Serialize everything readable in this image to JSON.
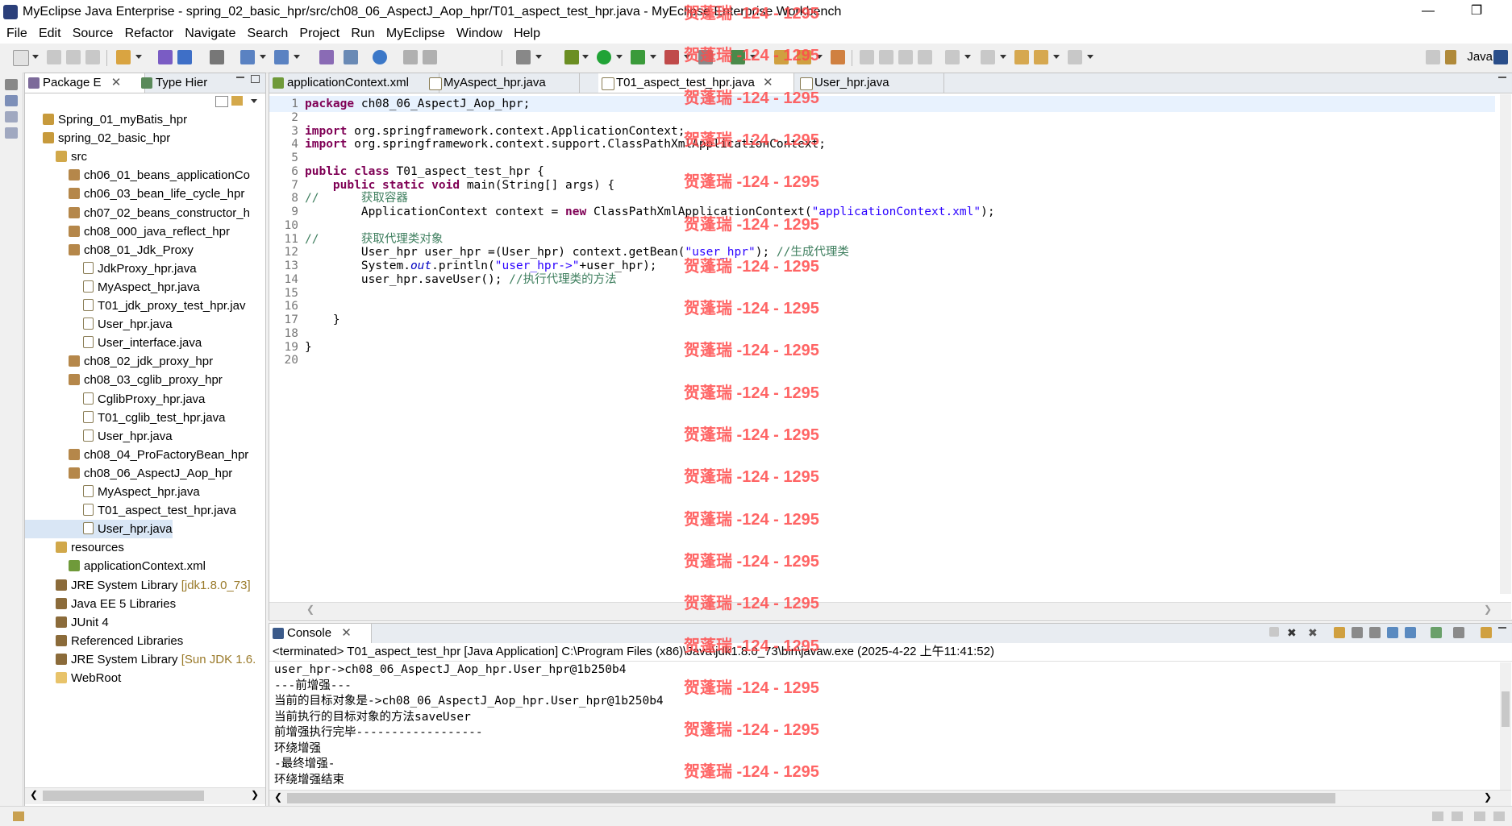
{
  "window": {
    "title": "MyEclipse Java Enterprise - spring_02_basic_hpr/src/ch08_06_AspectJ_Aop_hpr/T01_aspect_test_hpr.java - MyEclipse Enterprise Workbench",
    "minimize": "—",
    "restore": "❐"
  },
  "menu": [
    "File",
    "Edit",
    "Source",
    "Refactor",
    "Navigate",
    "Search",
    "Project",
    "Run",
    "MyEclipse",
    "Window",
    "Help"
  ],
  "toolbar": {
    "perspective": "Java"
  },
  "package_view": {
    "tabs": [
      "Package E",
      "Type Hier"
    ],
    "tree": [
      {
        "label": "Spring_01_myBatis_hpr",
        "type": "project",
        "level": 0
      },
      {
        "label": "spring_02_basic_hpr",
        "type": "project",
        "level": 0
      },
      {
        "label": "src",
        "type": "src",
        "level": 1
      },
      {
        "label": "ch06_01_beans_applicationCo",
        "type": "pkg",
        "level": 2
      },
      {
        "label": "ch06_03_bean_life_cycle_hpr",
        "type": "pkg",
        "level": 2
      },
      {
        "label": "ch07_02_beans_constructor_h",
        "type": "pkg",
        "level": 2
      },
      {
        "label": "ch08_000_java_reflect_hpr",
        "type": "pkg",
        "level": 2
      },
      {
        "label": "ch08_01_Jdk_Proxy",
        "type": "pkg",
        "level": 2
      },
      {
        "label": "JdkProxy_hpr.java",
        "type": "java",
        "level": 3
      },
      {
        "label": "MyAspect_hpr.java",
        "type": "java",
        "level": 3
      },
      {
        "label": "T01_jdk_proxy_test_hpr.jav",
        "type": "java",
        "level": 3
      },
      {
        "label": "User_hpr.java",
        "type": "java",
        "level": 3
      },
      {
        "label": "User_interface.java",
        "type": "java",
        "level": 3
      },
      {
        "label": "ch08_02_jdk_proxy_hpr",
        "type": "pkg",
        "level": 2
      },
      {
        "label": "ch08_03_cglib_proxy_hpr",
        "type": "pkg",
        "level": 2
      },
      {
        "label": "CglibProxy_hpr.java",
        "type": "java",
        "level": 3
      },
      {
        "label": "T01_cglib_test_hpr.java",
        "type": "java",
        "level": 3
      },
      {
        "label": "User_hpr.java",
        "type": "java",
        "level": 3
      },
      {
        "label": "ch08_04_ProFactoryBean_hpr",
        "type": "pkg",
        "level": 2
      },
      {
        "label": "ch08_06_AspectJ_Aop_hpr",
        "type": "pkg",
        "level": 2
      },
      {
        "label": "MyAspect_hpr.java",
        "type": "java",
        "level": 3
      },
      {
        "label": "T01_aspect_test_hpr.java",
        "type": "java",
        "level": 3
      },
      {
        "label": "User_hpr.java",
        "type": "java",
        "level": 3,
        "selected": true
      },
      {
        "label": "resources",
        "type": "src",
        "level": 1
      },
      {
        "label": "applicationContext.xml",
        "type": "xml",
        "level": 2
      },
      {
        "label": "JRE System Library",
        "decor": " [jdk1.8.0_73]",
        "type": "lib",
        "level": 1
      },
      {
        "label": "Java EE 5 Libraries",
        "type": "lib",
        "level": 1
      },
      {
        "label": "JUnit 4",
        "type": "lib",
        "level": 1
      },
      {
        "label": "Referenced Libraries",
        "type": "lib",
        "level": 1
      },
      {
        "label": "JRE System Library",
        "decor": " [Sun JDK 1.6.",
        "type": "lib",
        "level": 1
      },
      {
        "label": "WebRoot",
        "type": "folder",
        "level": 1
      }
    ]
  },
  "editor": {
    "tabs": [
      "applicationContext.xml",
      "MyAspect_hpr.java",
      "T01_aspect_test_hpr.java",
      "User_hpr.java"
    ],
    "active_tab": 2,
    "line_numbers": [
      "1",
      "2",
      "3",
      "4",
      "5",
      "6",
      "7",
      "8",
      "9",
      "10",
      "11",
      "12",
      "13",
      "14",
      "15",
      "16",
      "17",
      "18",
      "19",
      "20"
    ],
    "lines": [
      "package ch08_06_AspectJ_Aop_hpr;",
      "",
      "import org.springframework.context.ApplicationContext;",
      "import org.springframework.context.support.ClassPathXmlApplicationContext;",
      "",
      "public class T01_aspect_test_hpr {",
      "    public static void main(String[] args) {",
      "//      获取容器",
      "        ApplicationContext context = new ClassPathXmlApplicationContext(\"applicationContext.xml\");",
      "",
      "//      获取代理类对象",
      "        User_hpr user_hpr =(User_hpr) context.getBean(\"user_hpr\"); //生成代理类",
      "        System.out.println(\"user_hpr->\"+user_hpr);",
      "        user_hpr.saveUser(); //执行代理类的方法",
      "",
      "",
      "    }",
      "",
      "}",
      ""
    ]
  },
  "console": {
    "tab": "Console",
    "header": "<terminated> T01_aspect_test_hpr [Java Application] C:\\Program Files (x86)\\Java\\jdk1.8.0_73\\bin\\javaw.exe (2025-4-22 上午11:41:52)",
    "output": [
      "user_hpr->ch08_06_AspectJ_Aop_hpr.User_hpr@1b250b4",
      "---前增强---",
      "当前的目标对象是->ch08_06_AspectJ_Aop_hpr.User_hpr@1b250b4",
      "当前执行的目标对象的方法saveUser",
      "前增强执行完毕------------------",
      "环绕增强",
      "-最终增强-",
      "环绕增强结束"
    ]
  },
  "watermark": "贺蓬瑞 -124 - 1295",
  "icons": {
    "tree_project": "project-icon",
    "tree_package": "package-icon",
    "tree_java": "java-file-icon",
    "tree_lib": "library-icon",
    "run": "run-icon",
    "debug": "debug-icon"
  }
}
